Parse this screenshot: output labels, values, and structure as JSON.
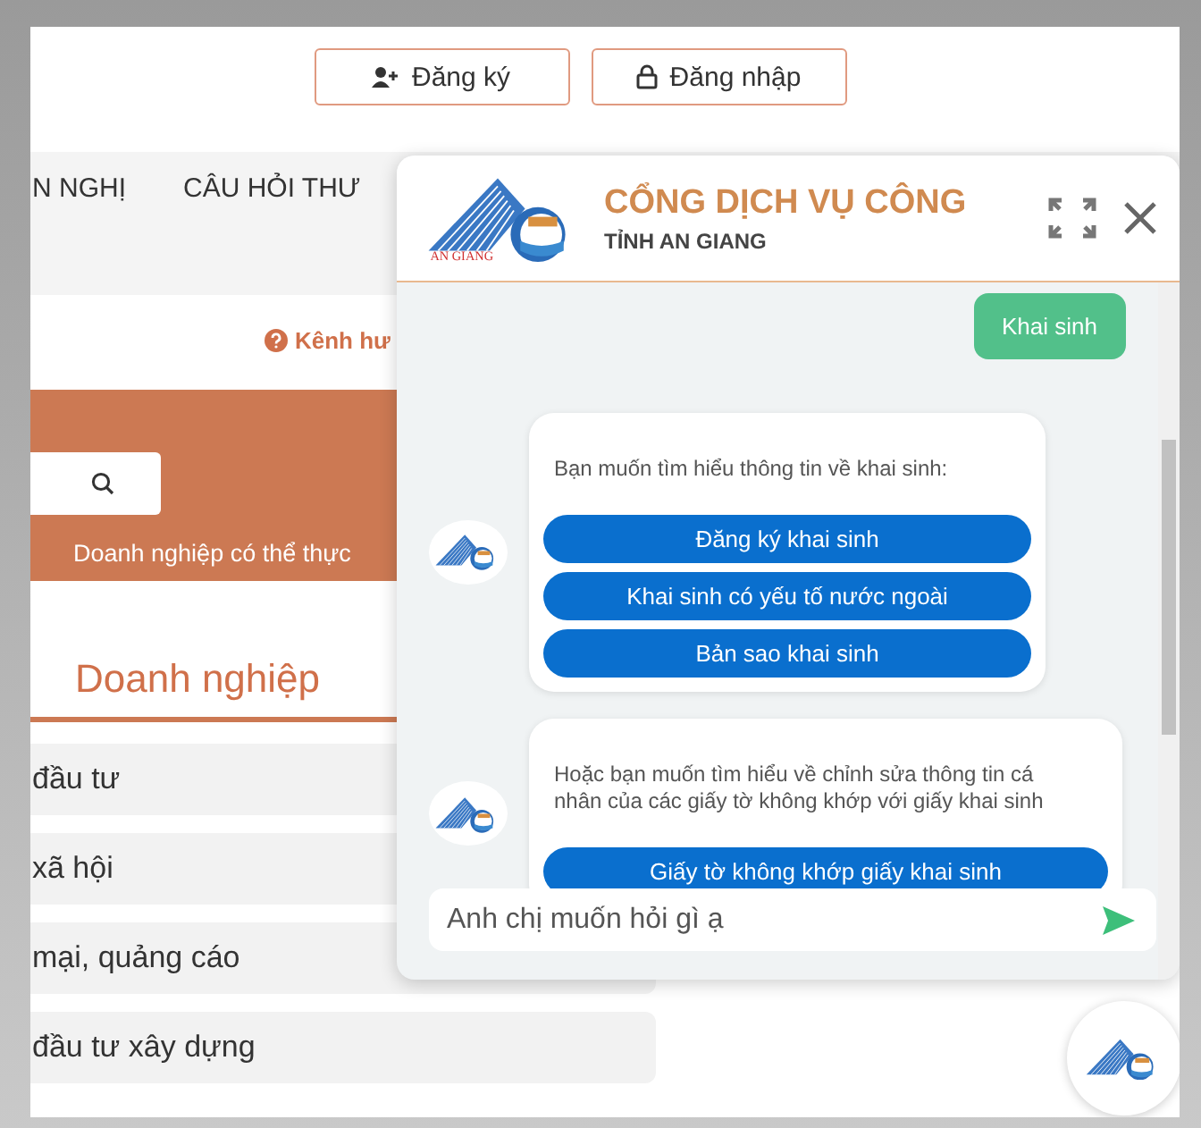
{
  "header": {
    "buttons": [
      {
        "label": "Đăng ký",
        "kind": "register"
      },
      {
        "label": "Đăng nhập",
        "kind": "login"
      }
    ]
  },
  "nav": {
    "items": [
      "N NGHỊ",
      "CÂU HỎI THƯ"
    ]
  },
  "notice": {
    "text": "Kênh hư"
  },
  "banner": {
    "caption": "Doanh nghiệp có thể thực"
  },
  "section": {
    "title": "Doanh nghiệp",
    "items": [
      "đầu tư",
      "xã hội",
      "mại, quảng cáo",
      "đầu tư xây dựng"
    ]
  },
  "chat": {
    "title": "CỔNG DỊCH VỤ CÔNG",
    "subtitle": "TỈNH AN GIANG",
    "logo_text": "AN GIANG",
    "messages": [
      {
        "kind": "user",
        "text": "Khai sinh"
      },
      {
        "kind": "bot",
        "text": "Bạn muốn tìm hiểu thông tin về khai sinh:",
        "options": [
          "Đăng ký khai sinh",
          "Khai sinh có yếu tố nước ngoài",
          "Bản sao khai sinh"
        ]
      },
      {
        "kind": "bot",
        "text": "Hoặc bạn muốn tìm hiểu về chỉnh sửa thông tin cá nhân của các giấy tờ không khớp với giấy khai sinh",
        "options": [
          "Giấy tờ không khớp giấy khai sinh"
        ]
      }
    ],
    "input": {
      "placeholder": "Anh chị muốn hỏi gì ạ"
    }
  }
}
